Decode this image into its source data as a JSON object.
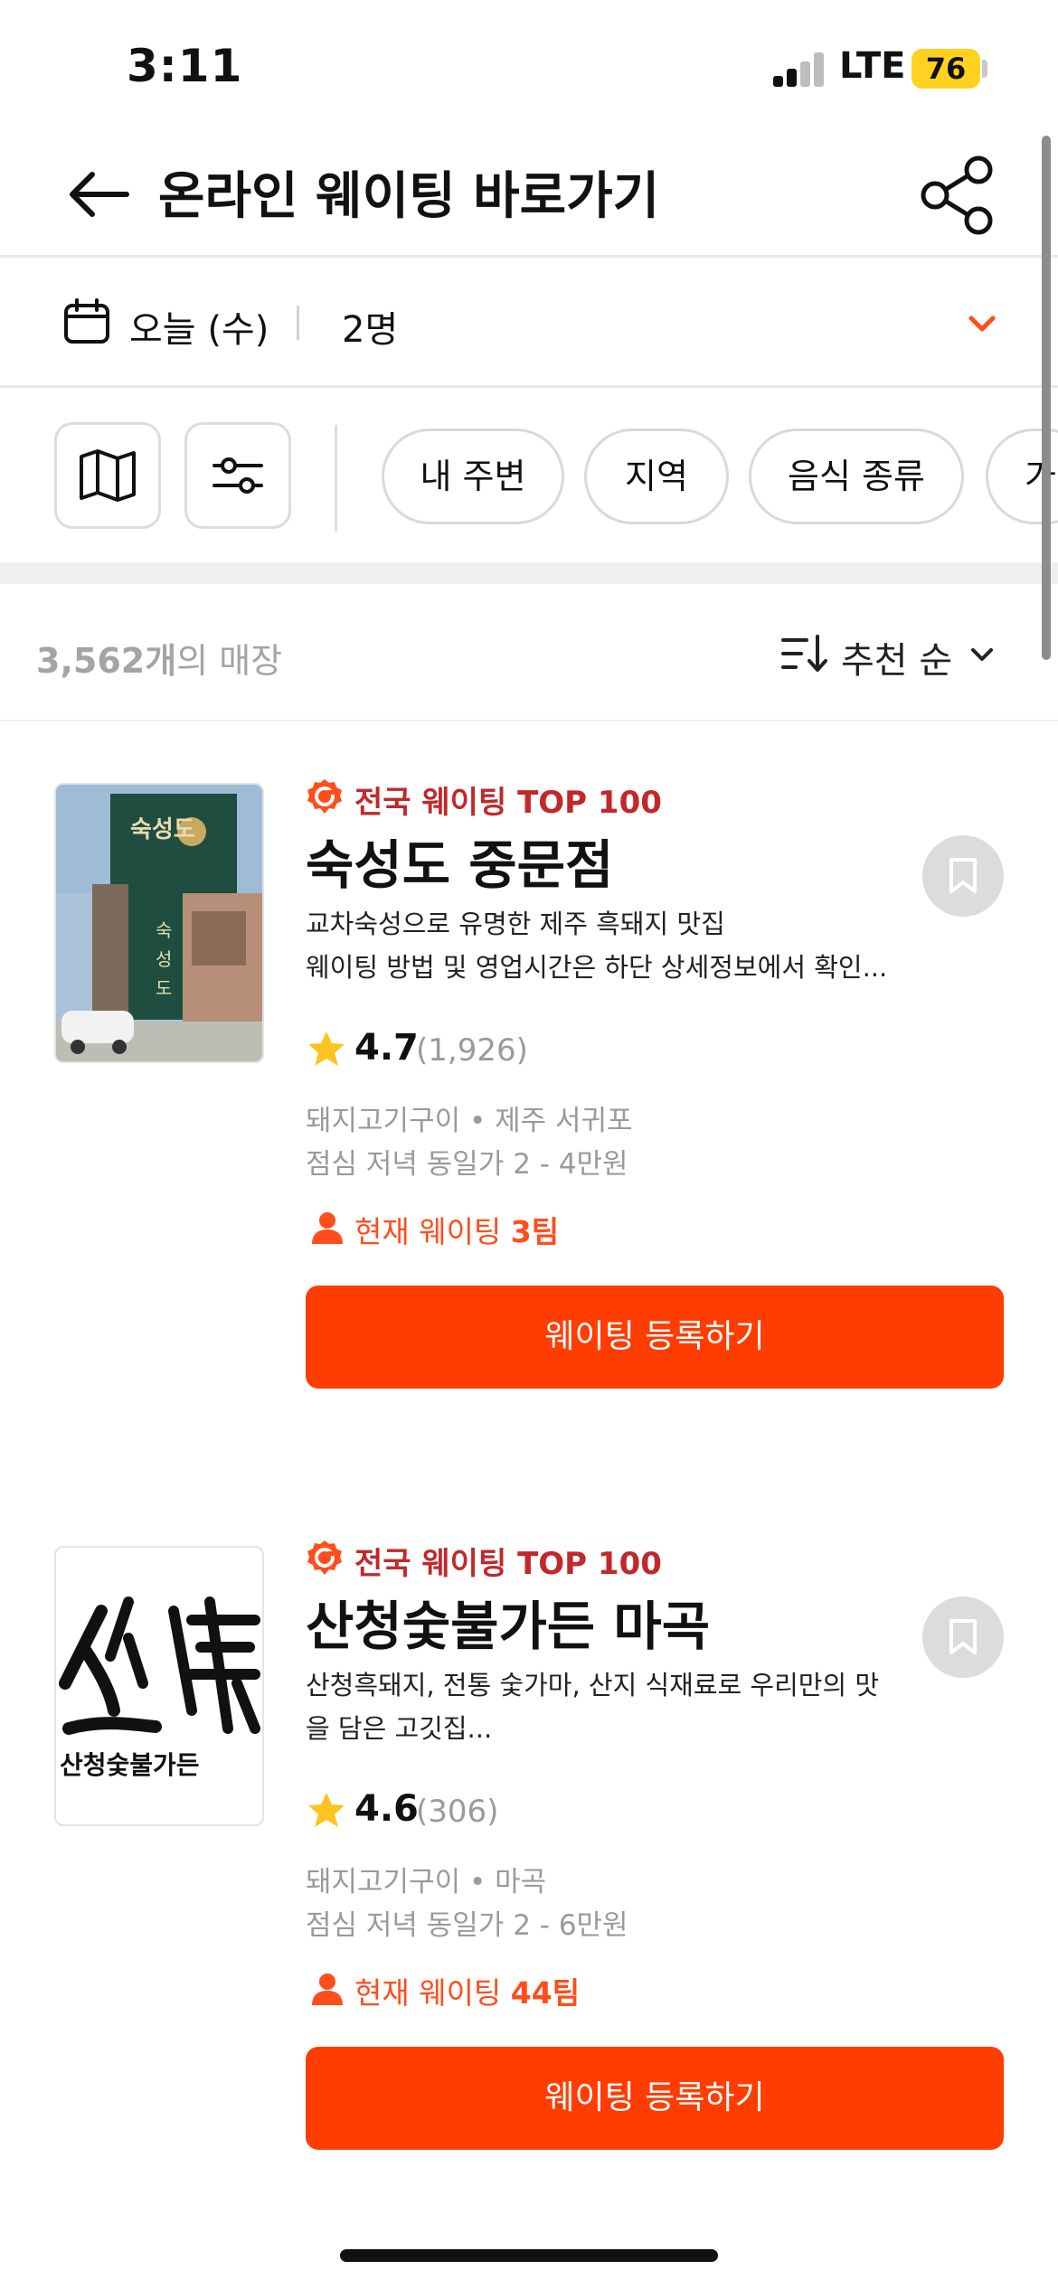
{
  "status": {
    "time": "3:11",
    "network": "LTE",
    "battery": "76"
  },
  "header": {
    "title": "온라인 웨이팅 바로가기"
  },
  "booking": {
    "date": "오늘 (수)",
    "party": "2명"
  },
  "filters": {
    "chips": [
      "내 주변",
      "지역",
      "음식 종류",
      "가"
    ]
  },
  "results": {
    "count": "3,562개",
    "count_suffix": "의 매장",
    "sort": "추천 순"
  },
  "restaurants": [
    {
      "badge": "전국 웨이팅 TOP 100",
      "name": "숙성도 중문점",
      "desc1": "교차숙성으로 유명한 제주 흑돼지 맛집",
      "desc2": "웨이팅 방법 및 영업시간은 하단 상세정보에서 확인...",
      "rating": "4.7",
      "reviews": "(1,926)",
      "category": "돼지고기구이 • 제주 서귀포",
      "price": "점심 저녁 동일가 2 - 4만원",
      "wait_label": "현재 웨이팅",
      "wait_count": "3팀",
      "cta": "웨이팅 등록하기",
      "sign_text": "숙성도",
      "sign_vertical": [
        "숙",
        "성",
        "도"
      ]
    },
    {
      "badge": "전국 웨이팅 TOP 100",
      "name": "산청숯불가든 마곡",
      "desc1": "산청흑돼지, 전통 숯가마, 산지 식재료로 우리만의 맛",
      "desc2": "을 담은 고깃집...",
      "rating": "4.6",
      "reviews": "(306)",
      "category": "돼지고기구이 • 마곡",
      "price": "점심 저녁 동일가 2 - 6만원",
      "wait_label": "현재 웨이팅",
      "wait_count": "44팀",
      "cta": "웨이팅 등록하기",
      "logo_text": "산청숯불가든"
    }
  ]
}
